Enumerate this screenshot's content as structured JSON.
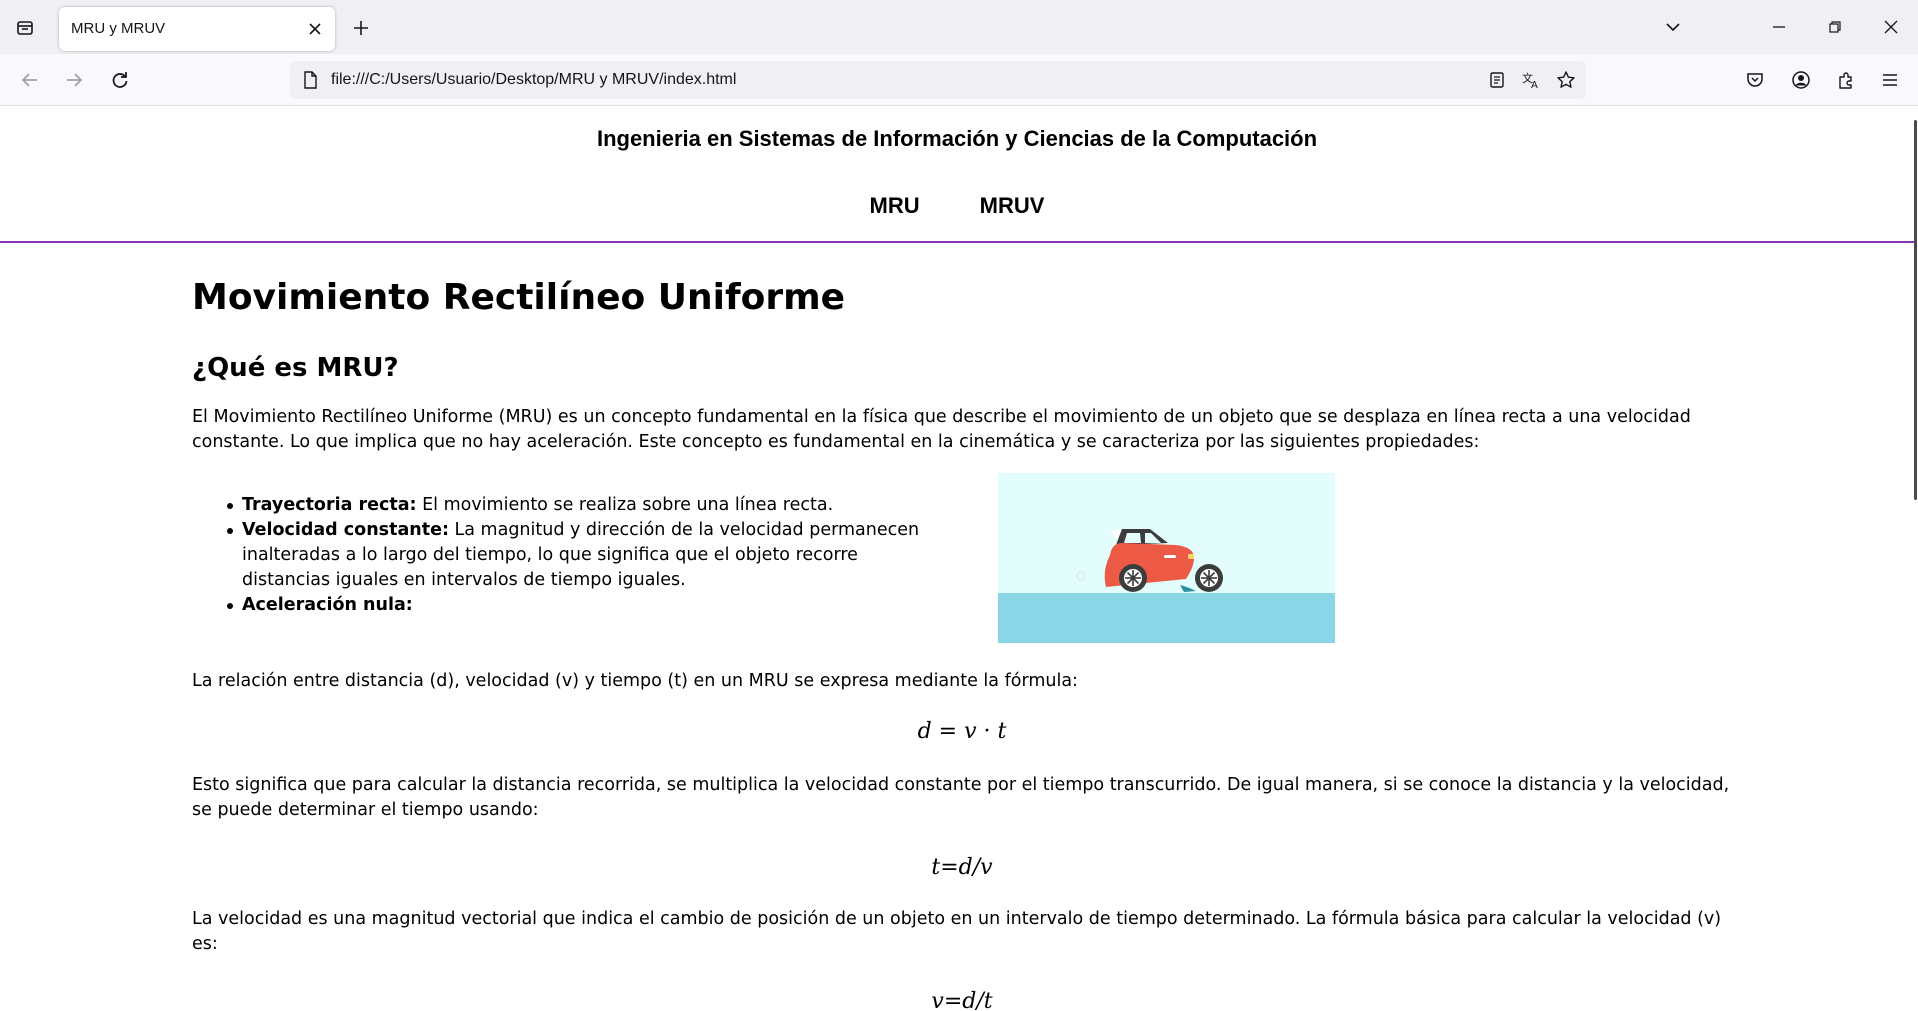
{
  "browser": {
    "tab_title": "MRU y MRUV",
    "url": "file:///C:/Users/Usuario/Desktop/MRU y MRUV/index.html",
    "accent_color": "#8e35b4"
  },
  "site": {
    "title": "Ingenieria en Sistemas de Información y Ciencias de la Computación",
    "nav": [
      "MRU",
      "MRUV"
    ]
  },
  "content": {
    "h1": "Movimiento Rectilíneo Uniforme",
    "h2": "¿Qué es MRU?",
    "p1": "El Movimiento Rectilíneo Uniforme (MRU) es un concepto fundamental en la física que describe el movimiento de un objeto que se desplaza en línea recta a una velocidad constante. Lo que implica que no hay aceleración. Este concepto es fundamental en la cinemática y se caracteriza por las siguientes propiedades:",
    "features": [
      {
        "term": "Trayectoria recta:",
        "desc": " El movimiento se realiza sobre una línea recta."
      },
      {
        "term": "Velocidad constante:",
        "desc": " La magnitud y dirección de la velocidad permanecen inalteradas a lo largo del tiempo, lo que significa que el objeto recorre distancias iguales en intervalos de tiempo iguales."
      },
      {
        "term": "Aceleración nula:",
        "desc": ""
      }
    ],
    "p2": "La relación entre distancia (d), velocidad (v) y tiempo (t) en un MRU se expresa mediante la fórmula:",
    "formula1": "d = v · t",
    "p3": "Esto significa que para calcular la distancia recorrida, se multiplica la velocidad constante por el tiempo transcurrido. De igual manera, si se conoce la distancia y la velocidad, se puede determinar el tiempo usando:",
    "formula2": "t=d/v",
    "p4": "La velocidad es una magnitud vectorial que indica el cambio de posición de un objeto en un intervalo de tiempo determinado. La fórmula básica para calcular la velocidad (v) es:",
    "formula3": "v=d/t"
  }
}
